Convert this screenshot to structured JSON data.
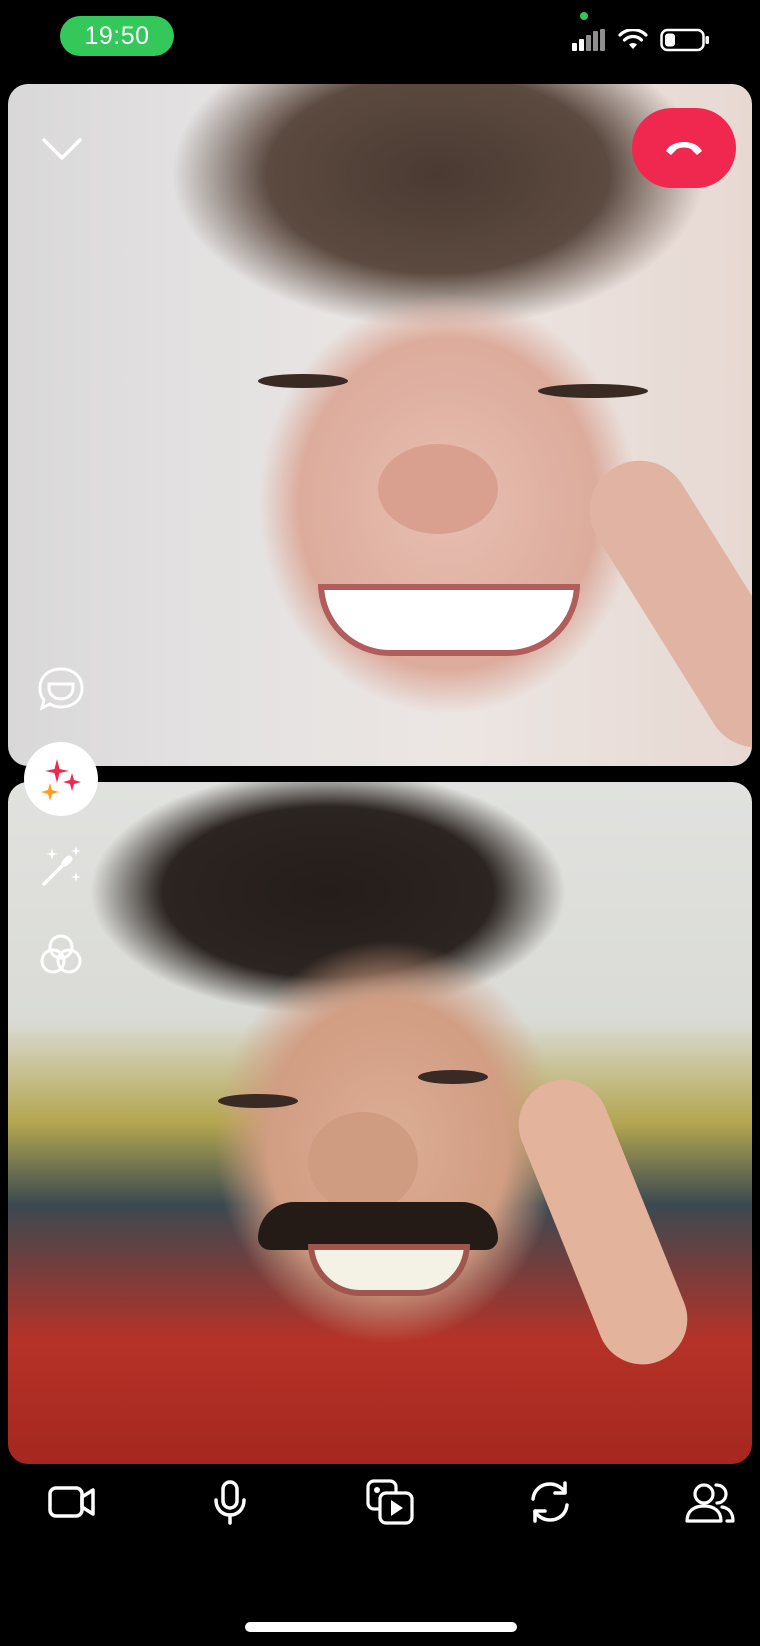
{
  "status_bar": {
    "time": "19:50",
    "icons": [
      "cellular-signal-icon",
      "wifi-icon",
      "battery-icon"
    ]
  },
  "call": {
    "top_tile": "remote-participant-video",
    "bottom_tile": "local-participant-video",
    "end_call_color": "#f0284f"
  },
  "side_tools": [
    "chat-bubble-icon",
    "sparkles-effects-icon",
    "magic-wand-icon",
    "filters-icon"
  ],
  "toolbar": {
    "buttons": [
      "video-camera-icon",
      "microphone-icon",
      "media-share-icon",
      "flip-camera-icon",
      "participants-icon"
    ]
  },
  "colors": {
    "accent_green": "#34c759",
    "end_call_red": "#f0284f"
  }
}
